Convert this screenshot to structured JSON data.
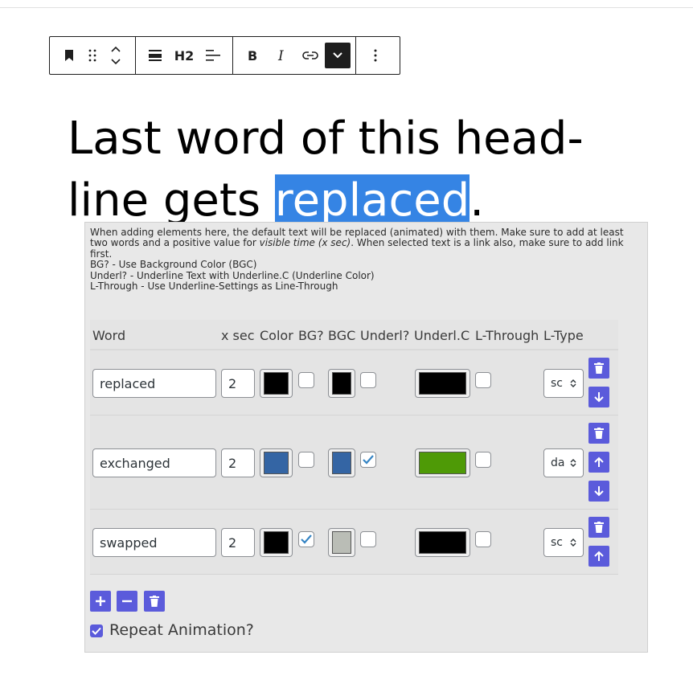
{
  "toolbar": {
    "heading_level": "H2",
    "buttons": [
      "bookmark-icon",
      "drag-handle-icon",
      "move-up-down-icon",
      "align-icon",
      "heading-level",
      "text-align-icon",
      "bold-icon",
      "italic-icon",
      "link-icon",
      "more-rich-text-icon",
      "options-icon"
    ]
  },
  "headline": {
    "text_before": "Last word of this head-line gets ",
    "line1": "Last word of this head-",
    "line2_before": "line gets ",
    "selected_word": "replaced",
    "after": "."
  },
  "panel": {
    "note_lines": [
      "When adding elements here, the default text will be replaced (animated) with them. Make sure to add at least",
      "two words and a positive value for",
      "visible time (x sec)",
      ". When selected text is a link also, make sure to add link",
      "first.",
      "BG? - Use Background Color (BGC)",
      "Underl? - Underline Text with Underline.C (Underline Color)",
      "L-Through - Use Underline-Settings as Line-Through"
    ],
    "columns": [
      "Word",
      "x sec",
      "Color",
      "BG?",
      "BGC",
      "Underl?",
      "Underl.C",
      "L-Through",
      "L-Type"
    ],
    "rows": [
      {
        "word": "replaced",
        "xsec": "2",
        "color": "#000000",
        "bg": false,
        "bgc": "#000000",
        "underl": false,
        "underlc": "#000000",
        "lthrough": false,
        "ltype": "solid",
        "ltype_visible": "sc"
      },
      {
        "word": "exchanged",
        "xsec": "2",
        "color": "#3465a4",
        "bg": false,
        "bgc": "#3465a4",
        "underl": true,
        "underlc": "#4e9a06",
        "lthrough": false,
        "ltype": "dashed",
        "ltype_visible": "da"
      },
      {
        "word": "swapped",
        "xsec": "2",
        "color": "#000000",
        "bg": true,
        "bgc": "#babdb6",
        "underl": false,
        "underlc": "#000000",
        "lthrough": false,
        "ltype": "solid",
        "ltype_visible": "sc"
      }
    ],
    "repeat_label": "Repeat Animation?",
    "repeat_checked": true,
    "accent": "#5b5bdb",
    "selection_color": "#3584e4"
  }
}
